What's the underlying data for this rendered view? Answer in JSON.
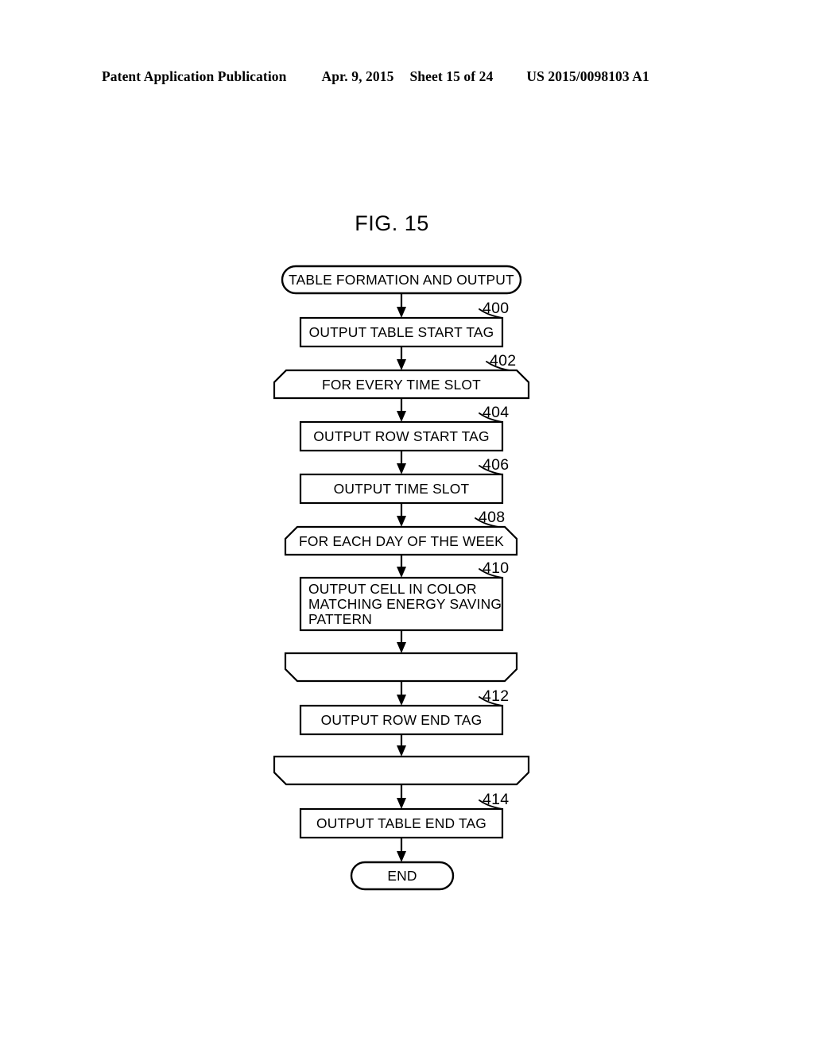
{
  "header": {
    "publication": "Patent Application Publication",
    "date": "Apr. 9, 2015",
    "sheet": "Sheet 15 of 24",
    "patent_number": "US 2015/0098103 A1"
  },
  "figure": {
    "title": "FIG. 15"
  },
  "flowchart": {
    "type": "flowchart",
    "nodes": [
      {
        "id": "start",
        "shape": "terminator",
        "label": "TABLE FORMATION AND OUTPUT",
        "ref": ""
      },
      {
        "id": "n400",
        "shape": "process",
        "label": "OUTPUT TABLE START TAG",
        "ref": "400"
      },
      {
        "id": "n402",
        "shape": "loop-start",
        "label": "FOR EVERY TIME SLOT",
        "ref": "402"
      },
      {
        "id": "n404",
        "shape": "process",
        "label": "OUTPUT ROW START TAG",
        "ref": "404"
      },
      {
        "id": "n406",
        "shape": "process",
        "label": "OUTPUT TIME SLOT",
        "ref": "406"
      },
      {
        "id": "n408",
        "shape": "loop-start",
        "label": "FOR EACH DAY OF THE WEEK",
        "ref": "408"
      },
      {
        "id": "n410",
        "shape": "process",
        "label": "OUTPUT CELL IN COLOR MATCHING ENERGY SAVING PATTERN",
        "ref": "410",
        "lines": [
          "OUTPUT CELL IN COLOR",
          "MATCHING ENERGY SAVING",
          "PATTERN"
        ]
      },
      {
        "id": "loopend1",
        "shape": "loop-end",
        "label": "",
        "ref": ""
      },
      {
        "id": "n412",
        "shape": "process",
        "label": "OUTPUT ROW END TAG",
        "ref": "412"
      },
      {
        "id": "loopend2",
        "shape": "loop-end",
        "label": "",
        "ref": ""
      },
      {
        "id": "n414",
        "shape": "process",
        "label": "OUTPUT TABLE END TAG",
        "ref": "414"
      },
      {
        "id": "end",
        "shape": "terminator",
        "label": "END",
        "ref": ""
      }
    ],
    "edges": [
      {
        "from": "start",
        "to": "n400"
      },
      {
        "from": "n400",
        "to": "n402"
      },
      {
        "from": "n402",
        "to": "n404"
      },
      {
        "from": "n404",
        "to": "n406"
      },
      {
        "from": "n406",
        "to": "n408"
      },
      {
        "from": "n408",
        "to": "n410"
      },
      {
        "from": "n410",
        "to": "loopend1"
      },
      {
        "from": "loopend1",
        "to": "n412"
      },
      {
        "from": "n412",
        "to": "loopend2"
      },
      {
        "from": "loopend2",
        "to": "n414"
      },
      {
        "from": "n414",
        "to": "end"
      }
    ],
    "colors": {
      "line": "#000000",
      "fill": "#ffffff",
      "text": "#000000"
    }
  }
}
